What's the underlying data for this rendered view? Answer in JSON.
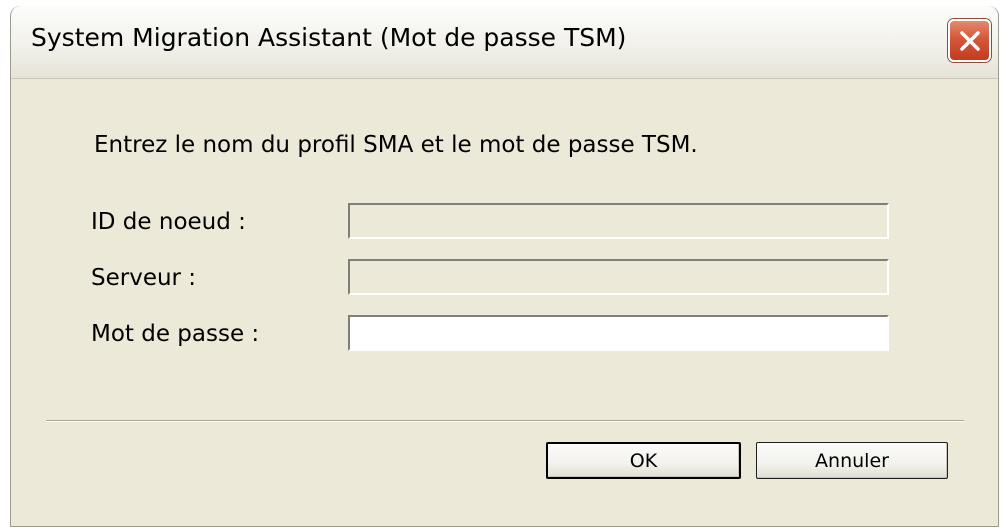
{
  "window": {
    "title": "System Migration Assistant (Mot de passe TSM)"
  },
  "prompt": "Entrez le nom du profil SMA et le mot de passe TSM.",
  "fields": [
    {
      "label": "ID de noeud :",
      "value": "",
      "enabled": false
    },
    {
      "label": "Serveur :",
      "value": "",
      "enabled": false
    },
    {
      "label": "Mot de passe :",
      "value": "",
      "enabled": true
    }
  ],
  "buttons": {
    "ok_label": "OK",
    "cancel_label": "Annuler"
  },
  "icons": {
    "close": "close-icon"
  },
  "colors": {
    "dialog_background": "#ece9d8",
    "close_button": "#d5573a"
  }
}
